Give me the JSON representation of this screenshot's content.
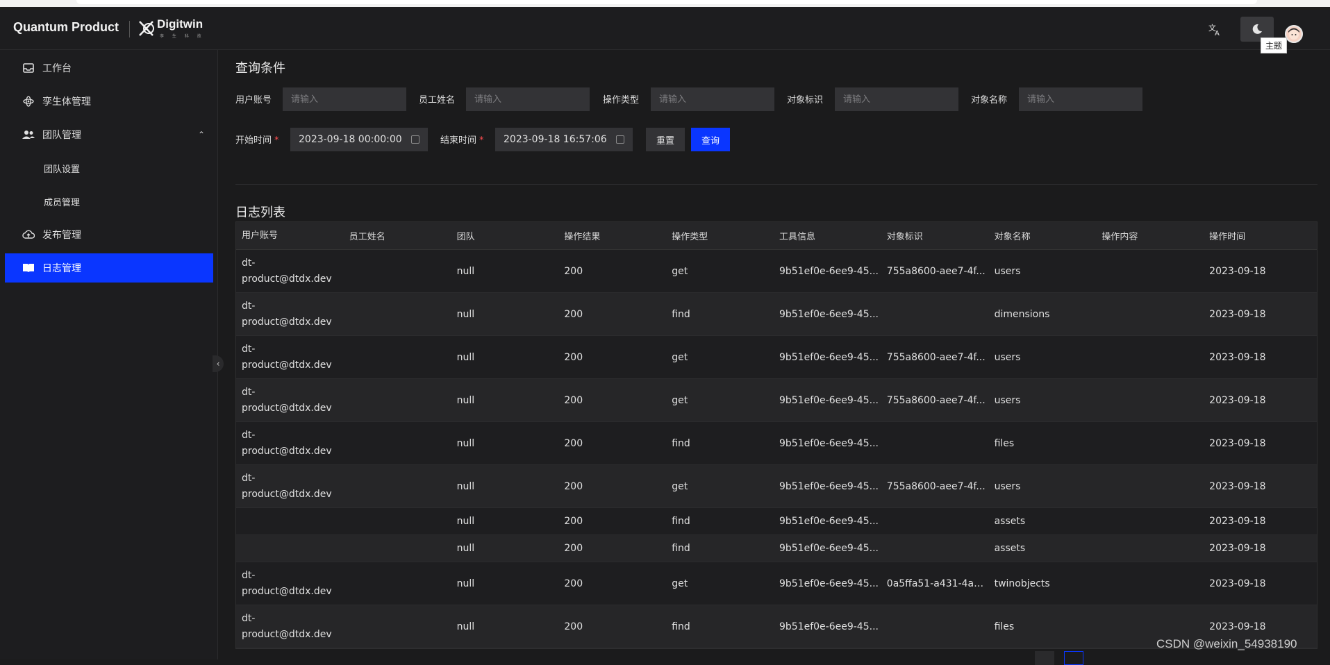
{
  "app": {
    "brand": "Quantum Product",
    "logo_text": "Digitwin",
    "logo_sub": "孪 生 科 技",
    "tooltip": "主题"
  },
  "sidebar": {
    "items": [
      {
        "label": "工作台",
        "icon": "inbox-icon"
      },
      {
        "label": "孪生体管理",
        "icon": "atom-icon"
      },
      {
        "label": "团队管理",
        "icon": "team-icon"
      },
      {
        "label": "团队设置"
      },
      {
        "label": "成员管理"
      },
      {
        "label": "发布管理",
        "icon": "cloud-upload-icon"
      },
      {
        "label": "日志管理",
        "icon": "book-icon"
      }
    ]
  },
  "filters": {
    "title": "查询条件",
    "user_account": {
      "label": "用户账号",
      "placeholder": "请输入"
    },
    "employee_name": {
      "label": "员工姓名",
      "placeholder": "请输入"
    },
    "op_type": {
      "label": "操作类型",
      "placeholder": "请输入"
    },
    "object_id": {
      "label": "对象标识",
      "placeholder": "请输入"
    },
    "object_name": {
      "label": "对象名称",
      "placeholder": "请输入"
    },
    "start_time": {
      "label": "开始时间",
      "value": "2023-09-18 00:00:00"
    },
    "end_time": {
      "label": "结束时间",
      "value": "2023-09-18 16:57:06"
    },
    "required_mark": "*",
    "reset_label": "重置",
    "query_label": "查询"
  },
  "table": {
    "title": "日志列表",
    "headers": [
      "用户账号",
      "员工姓名",
      "团队",
      "操作结果",
      "操作类型",
      "工具信息",
      "对象标识",
      "对象名称",
      "操作内容",
      "操作时间"
    ],
    "rows": [
      {
        "account_a": "dt-",
        "account_b": "product@dtdx.dev",
        "team": "null",
        "result": "200",
        "type": "get",
        "tool": "9b51ef0e-6ee9-45...",
        "object_id": "755a8600-aee7-4f...",
        "object_name": "users",
        "time": "2023-09-18"
      },
      {
        "account_a": "dt-",
        "account_b": "product@dtdx.dev",
        "team": "null",
        "result": "200",
        "type": "find",
        "tool": "9b51ef0e-6ee9-45...",
        "object_id": "",
        "object_name": "dimensions",
        "time": "2023-09-18"
      },
      {
        "account_a": "dt-",
        "account_b": "product@dtdx.dev",
        "team": "null",
        "result": "200",
        "type": "get",
        "tool": "9b51ef0e-6ee9-45...",
        "object_id": "755a8600-aee7-4f...",
        "object_name": "users",
        "time": "2023-09-18"
      },
      {
        "account_a": "dt-",
        "account_b": "product@dtdx.dev",
        "team": "null",
        "result": "200",
        "type": "get",
        "tool": "9b51ef0e-6ee9-45...",
        "object_id": "755a8600-aee7-4f...",
        "object_name": "users",
        "time": "2023-09-18"
      },
      {
        "account_a": "dt-",
        "account_b": "product@dtdx.dev",
        "team": "null",
        "result": "200",
        "type": "find",
        "tool": "9b51ef0e-6ee9-45...",
        "object_id": "",
        "object_name": "files",
        "time": "2023-09-18"
      },
      {
        "account_a": "dt-",
        "account_b": "product@dtdx.dev",
        "team": "null",
        "result": "200",
        "type": "get",
        "tool": "9b51ef0e-6ee9-45...",
        "object_id": "755a8600-aee7-4f...",
        "object_name": "users",
        "time": "2023-09-18"
      },
      {
        "account_a": "",
        "account_b": "",
        "team": "null",
        "result": "200",
        "type": "find",
        "tool": "9b51ef0e-6ee9-45...",
        "object_id": "",
        "object_name": "assets",
        "time": "2023-09-18"
      },
      {
        "account_a": "",
        "account_b": "",
        "team": "null",
        "result": "200",
        "type": "find",
        "tool": "9b51ef0e-6ee9-45...",
        "object_id": "",
        "object_name": "assets",
        "time": "2023-09-18"
      },
      {
        "account_a": "dt-",
        "account_b": "product@dtdx.dev",
        "team": "null",
        "result": "200",
        "type": "get",
        "tool": "9b51ef0e-6ee9-45...",
        "object_id": "0a5ffa51-a431-4a7...",
        "object_name": "twinobjects",
        "time": "2023-09-18"
      },
      {
        "account_a": "dt-",
        "account_b": "product@dtdx.dev",
        "team": "null",
        "result": "200",
        "type": "find",
        "tool": "9b51ef0e-6ee9-45...",
        "object_id": "",
        "object_name": "files",
        "time": "2023-09-18"
      }
    ]
  },
  "watermark": "CSDN @weixin_54938190",
  "colors": {
    "accent": "#0a36ff",
    "background": "#1b1b1c",
    "required": "#ff4d4f"
  }
}
